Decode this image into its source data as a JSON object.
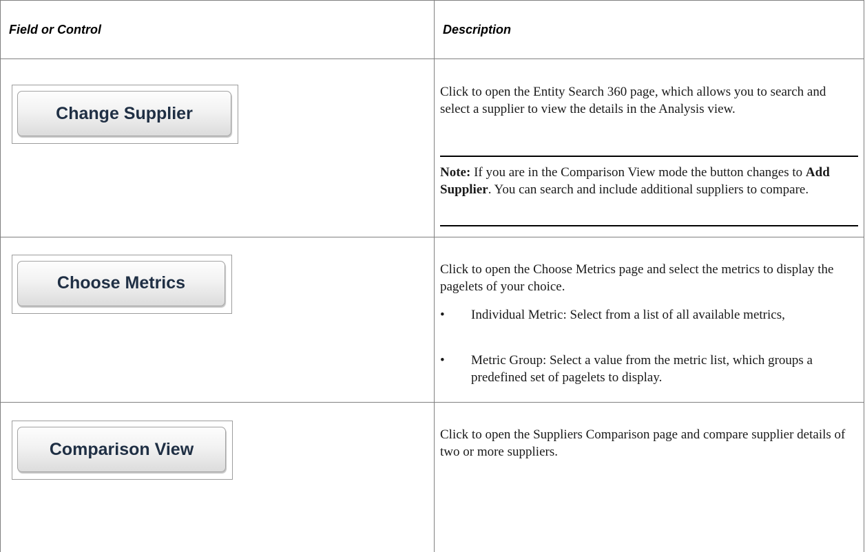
{
  "header": {
    "field_col": "Field or Control",
    "desc_col": "Description"
  },
  "rows": [
    {
      "button_label": "Change Supplier",
      "description": "Click to open the Entity Search 360 page, which allows you to search and select a supplier to view the details in the Analysis view.",
      "note": {
        "label": "Note:",
        "text_before": " If you are in the Comparison View mode the button changes to ",
        "bold_term": "Add Supplier",
        "text_after": ". You can search and include additional suppliers to compare."
      }
    },
    {
      "button_label": "Choose Metrics",
      "description": "Click to open the Choose Metrics page and select the metrics to display the pagelets of your choice.",
      "bullets": [
        "Individual Metric: Select from a list of all available metrics,",
        "Metric Group: Select a value from the metric list, which groups a predefined set of pagelets to display."
      ],
      "bullet_symbol": "•"
    },
    {
      "button_label": "Comparison View",
      "description": "Click to open the Suppliers Comparison page and compare supplier details of two or more suppliers."
    }
  ]
}
